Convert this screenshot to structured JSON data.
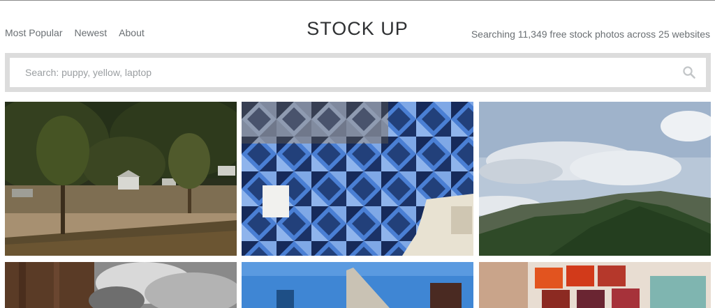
{
  "nav": {
    "items": [
      {
        "label": "Most Popular"
      },
      {
        "label": "Newest"
      },
      {
        "label": "About"
      }
    ]
  },
  "site": {
    "title": "STOCK UP",
    "tagline": "Searching 11,349 free stock photos across 25 websites"
  },
  "search": {
    "placeholder": "Search: puppy, yellow, laptop",
    "icon": "search-icon"
  },
  "photos": [
    {
      "name": "photo-flood-damaged-riverside-town"
    },
    {
      "name": "photo-blue-triangle-tile-wall"
    },
    {
      "name": "photo-cloudy-sky-mountains"
    },
    {
      "name": "photo-tree-bark-clouds"
    },
    {
      "name": "photo-flatiron-building"
    },
    {
      "name": "photo-watercolor-paint-palette"
    }
  ],
  "colors": {
    "search_frame": "#dcdcdc",
    "text_muted": "#6a6f73",
    "title_text": "#2f3133"
  }
}
